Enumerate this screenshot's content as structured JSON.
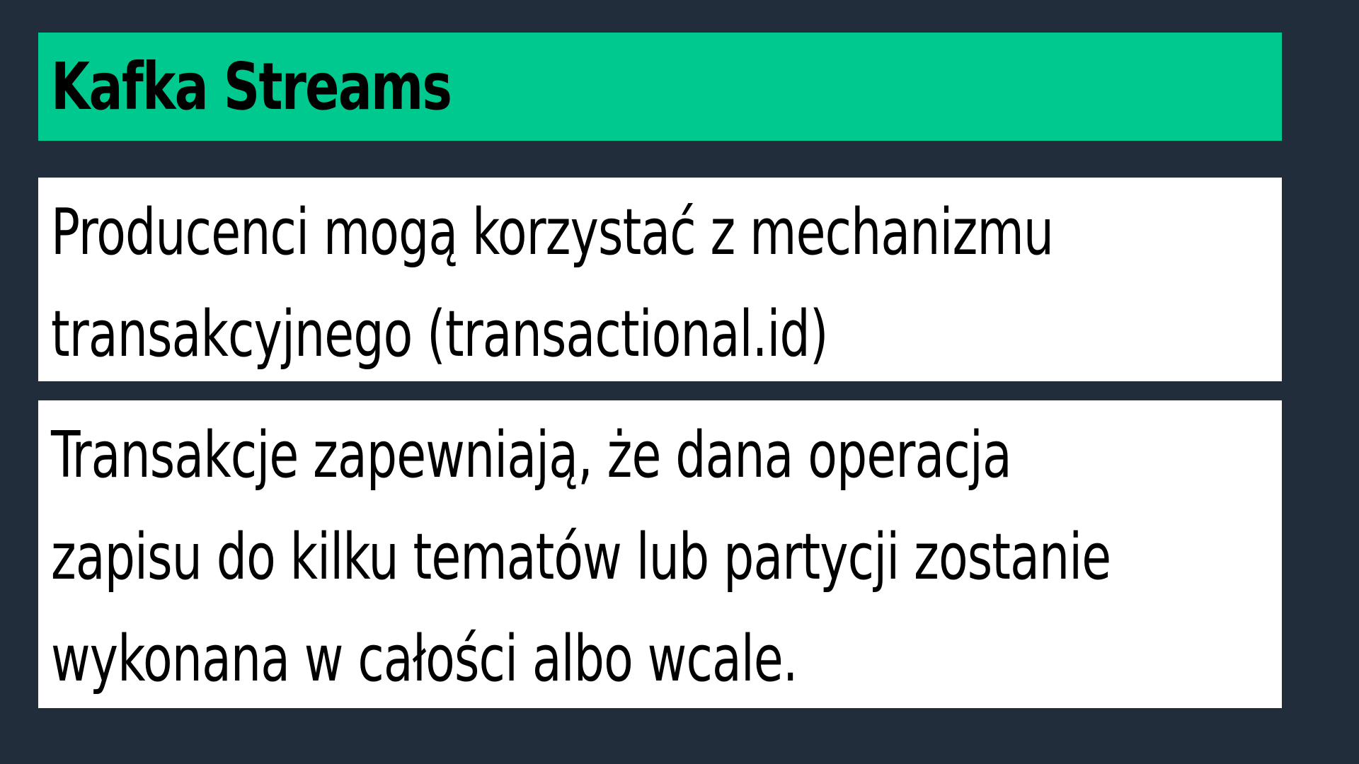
{
  "slide": {
    "title": "Kafka Streams",
    "box1": {
      "lines": [
        "Producenci mogą korzystać z mechanizmu",
        "transakcyjnego (transactional.id)"
      ]
    },
    "box2": {
      "lines": [
        "Transakcje zapewniają, że dana operacja",
        "zapisu do kilku tematów lub partycji zostanie",
        "wykonana w całości albo wcale."
      ]
    }
  },
  "colors": {
    "background": "#222d3c",
    "title_bar": "#00c98f",
    "box": "#ffffff",
    "text": "#000000"
  }
}
